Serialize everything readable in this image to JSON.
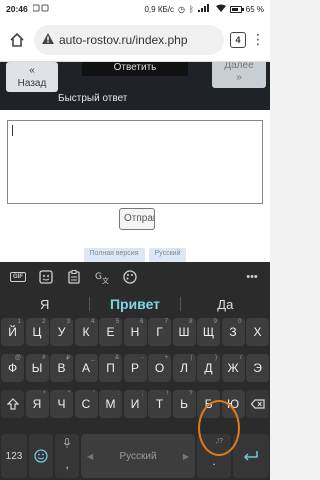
{
  "status_bar": {
    "time": "20:46",
    "network_speed": "0,9 КБ/с",
    "battery": "65 %",
    "battery_level": 0.65
  },
  "browser": {
    "url": "auto-rostov.ru/index.php",
    "tab_count": "4"
  },
  "page": {
    "back_button": "Назад",
    "back_arrow": "«",
    "reply_button": "Ответить",
    "next_button": "Далее",
    "next_arrow": "»",
    "quick_reply_label": "Быстрый ответ",
    "textarea_value": "",
    "send_button": "Отправить",
    "footer_links": [
      "Полная версия",
      "Русский"
    ]
  },
  "keyboard": {
    "toolbar_gif": "GIF",
    "suggestions": [
      "Я",
      "Привет",
      "Да"
    ],
    "row1": [
      {
        "key": "Й",
        "hint": "1"
      },
      {
        "key": "Ц",
        "hint": "2"
      },
      {
        "key": "У",
        "hint": "3"
      },
      {
        "key": "К",
        "hint": "4"
      },
      {
        "key": "Е",
        "hint": "5"
      },
      {
        "key": "Н",
        "hint": "6"
      },
      {
        "key": "Г",
        "hint": "7"
      },
      {
        "key": "Ш",
        "hint": "8"
      },
      {
        "key": "Щ",
        "hint": "9"
      },
      {
        "key": "З",
        "hint": "0"
      },
      {
        "key": "Х",
        "hint": ""
      }
    ],
    "row2": [
      {
        "key": "Ф",
        "hint": "@"
      },
      {
        "key": "Ы",
        "hint": "#"
      },
      {
        "key": "В",
        "hint": "₽"
      },
      {
        "key": "А",
        "hint": "_"
      },
      {
        "key": "П",
        "hint": "&"
      },
      {
        "key": "Р",
        "hint": "-"
      },
      {
        "key": "О",
        "hint": "+"
      },
      {
        "key": "Л",
        "hint": "("
      },
      {
        "key": "Д",
        "hint": ")"
      },
      {
        "key": "Ж",
        "hint": "/"
      },
      {
        "key": "Э",
        "hint": ""
      }
    ],
    "row3": [
      {
        "key": "Я",
        "hint": "*"
      },
      {
        "key": "Ч",
        "hint": "\""
      },
      {
        "key": "С",
        "hint": "'"
      },
      {
        "key": "М",
        "hint": ":"
      },
      {
        "key": "И",
        "hint": ";"
      },
      {
        "key": "Т",
        "hint": "!"
      },
      {
        "key": "Ь",
        "hint": "?"
      },
      {
        "key": "Б",
        "hint": ""
      },
      {
        "key": "Ю",
        "hint": ""
      }
    ],
    "numbers_key": "123",
    "comma": ",",
    "space_label": "Русский",
    "period": ".",
    "period_hint": ",!?"
  },
  "colors": {
    "keyboard_bg": "#2b2b2b",
    "key_bg": "#3d3d3d",
    "accent": "#7fd4e2",
    "annotation": "#e07a1c"
  }
}
